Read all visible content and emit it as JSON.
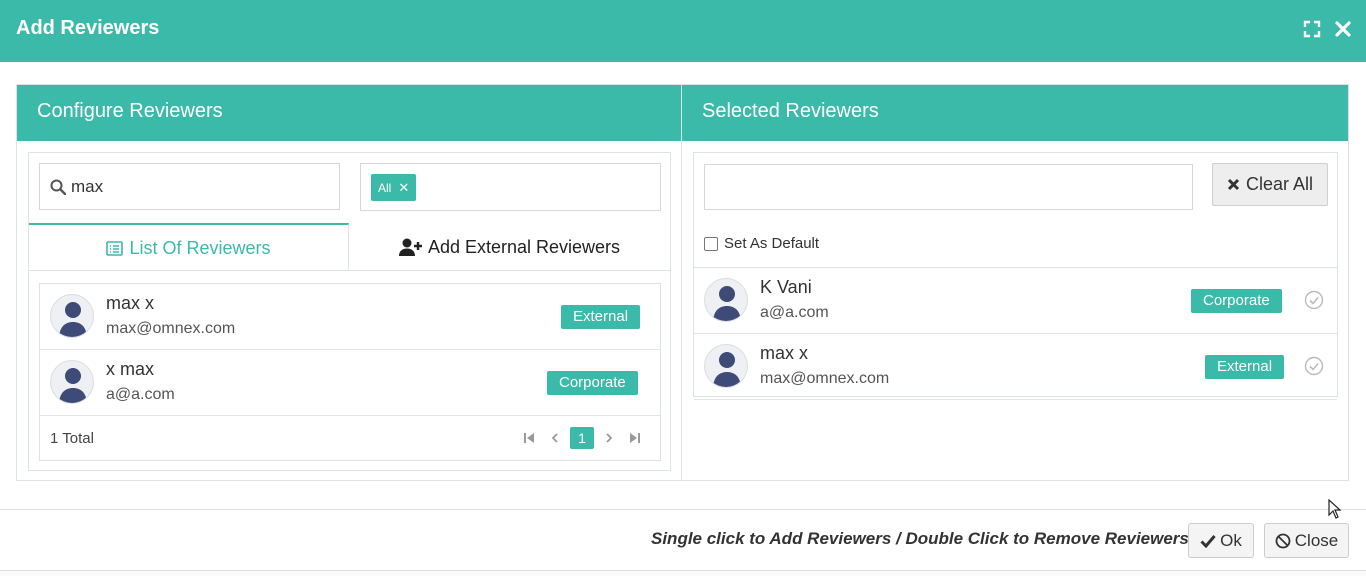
{
  "modal": {
    "title": "Add Reviewers"
  },
  "configure": {
    "heading": "Configure Reviewers",
    "search_value": "max",
    "filter_chip": "All",
    "tabs": {
      "list": "List Of Reviewers",
      "external": "Add External Reviewers"
    },
    "rows": [
      {
        "name": "max x",
        "email": "max@omnex.com",
        "badge": "External"
      },
      {
        "name": "x max",
        "email": "a@a.com",
        "badge": "Corporate"
      }
    ],
    "total": "1 Total",
    "current_page": "1"
  },
  "selected": {
    "heading": "Selected Reviewers",
    "clear_all": "Clear All",
    "set_default": "Set As Default",
    "rows": [
      {
        "name": "K Vani",
        "email": "a@a.com",
        "badge": "Corporate"
      },
      {
        "name": "max x",
        "email": "max@omnex.com",
        "badge": "External"
      }
    ]
  },
  "footer": {
    "hint": "Single click to Add Reviewers / Double Click to Remove Reviewers",
    "ok": "Ok",
    "close": "Close"
  },
  "colors": {
    "accent": "#3bb9a9"
  }
}
